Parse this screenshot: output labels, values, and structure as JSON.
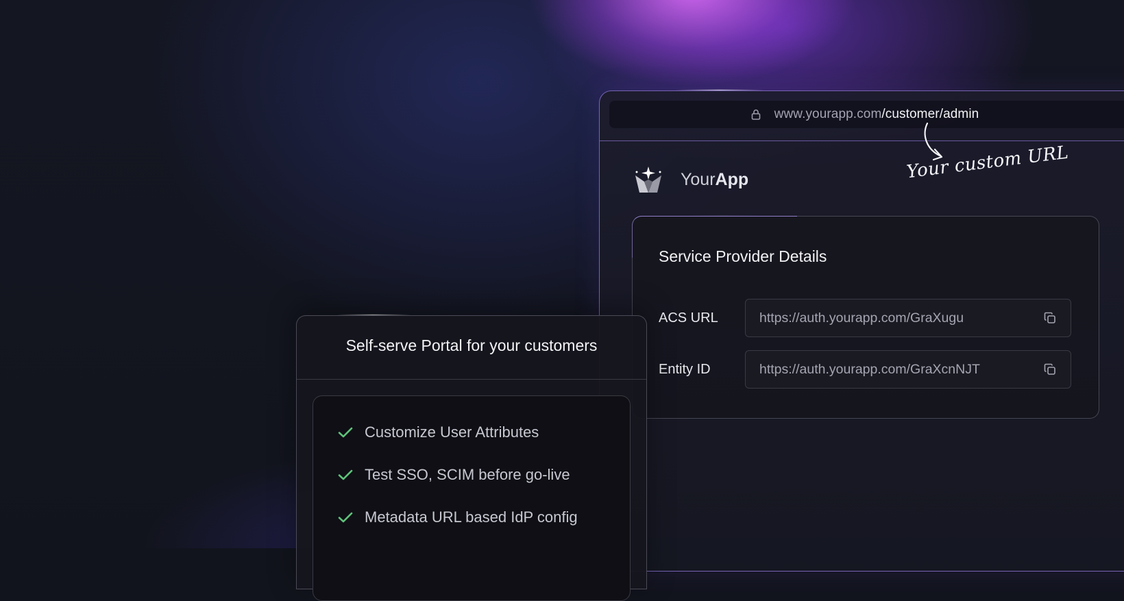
{
  "browser": {
    "url_base": "www.yourapp.com",
    "url_path": "/customer/admin"
  },
  "logo": {
    "word1": "Your",
    "word2": "App"
  },
  "annotation": {
    "text": "Your custom URL"
  },
  "sp_card": {
    "title": "Service Provider Details",
    "rows": [
      {
        "label": "ACS URL",
        "value": "https://auth.yourapp.com/GraXugu"
      },
      {
        "label": "Entity ID",
        "value": "https://auth.yourapp.com/GraXcnNJT"
      }
    ]
  },
  "portal": {
    "title": "Self-serve Portal for your customers",
    "features": [
      "Customize User Attributes",
      "Test SSO, SCIM before go-live",
      "Metadata URL based IdP config"
    ]
  },
  "colors": {
    "accent_purple": "#a98cff",
    "check_green": "#5fc27a"
  },
  "icons": {
    "lock": "lock-icon",
    "copy": "copy-icon",
    "check": "check-icon",
    "logo": "crown-star-logo"
  }
}
